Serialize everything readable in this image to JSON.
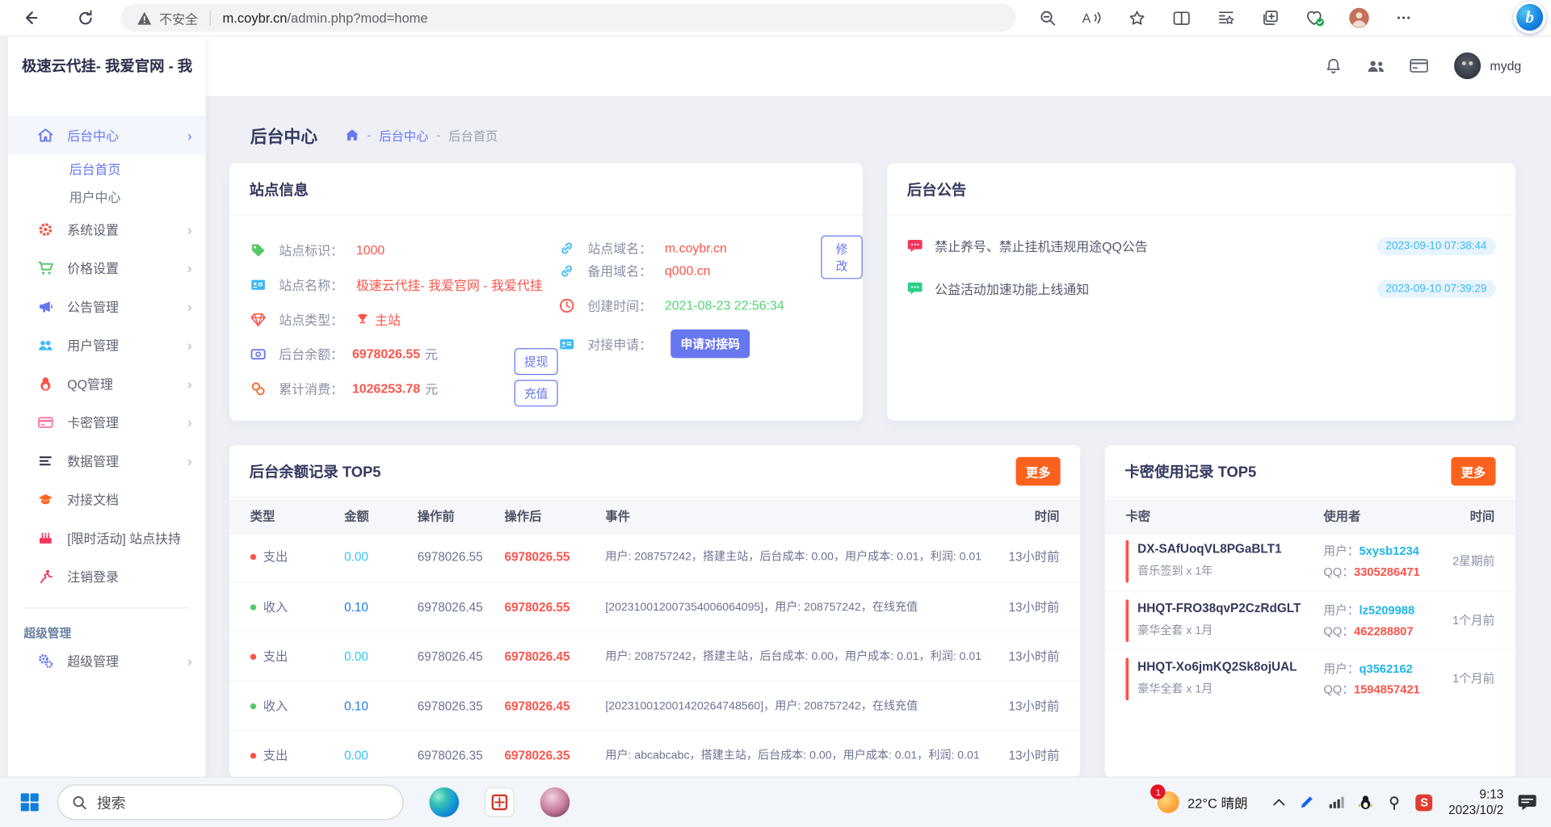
{
  "colors": {
    "accent": "#6777ef",
    "red": "#fc544b",
    "green": "#54ca68",
    "cyan": "#3abaf4",
    "orange_more": "#fb621e",
    "income_blue": "#1d7ce8",
    "time_green": "#4fd473"
  },
  "browser": {
    "security_label": "不安全",
    "url_domain": "m.coybr.cn",
    "url_path": "/admin.php?mod=home"
  },
  "sidebar": {
    "logo": "极速云代挂- 我爱官网 - 我",
    "items": [
      {
        "label": "后台中心"
      },
      {
        "label": "系统设置"
      },
      {
        "label": "价格设置"
      },
      {
        "label": "公告管理"
      },
      {
        "label": "用户管理"
      },
      {
        "label": "QQ管理"
      },
      {
        "label": "卡密管理"
      },
      {
        "label": "数据管理"
      },
      {
        "label": "对接文档"
      },
      {
        "label": "[限时活动] 站点扶持"
      },
      {
        "label": "注销登录"
      }
    ],
    "submenu": [
      {
        "label": "后台首页"
      },
      {
        "label": "用户中心"
      }
    ],
    "section_label": "超级管理",
    "super_item": "超级管理"
  },
  "topbar": {
    "username": "mydg"
  },
  "page": {
    "title": "后台中心",
    "sep": "-",
    "breadcrumb_1": "后台中心",
    "breadcrumb_2": "后台首页"
  },
  "site_info": {
    "title": "站点信息",
    "site_id_label": "站点标识：",
    "site_id": "1000",
    "site_name_label": "站点名称：",
    "site_name": "极速云代挂- 我爱官网 - 我爱代挂",
    "site_type_label": "站点类型：",
    "site_type": "主站",
    "balance_label": "后台余额：",
    "balance": "6978026.55",
    "balance_unit": "元",
    "withdraw_label": "提现",
    "consume_label": "累计消费：",
    "consume": "1026253.78",
    "consume_unit": "元",
    "recharge_label": "充值",
    "domain_label": "站点域名：",
    "domain": "m.coybr.cn",
    "modify_label": "修改",
    "backup_domain_label": "备用域名：",
    "backup_domain": "q000.cn",
    "created_label": "创建时间：",
    "created": "2021-08-23 22:56:34",
    "apply_label": "对接申请：",
    "apply_button": "申请对接码"
  },
  "announcements": {
    "title": "后台公告",
    "items": [
      {
        "text": "禁止养号、禁止挂机违规用途QQ公告",
        "time": "2023-09-10 07:38:44"
      },
      {
        "text": "公益活动加速功能上线通知",
        "time": "2023-09-10 07:39:29"
      }
    ]
  },
  "balance_records": {
    "title": "后台余额记录 TOP5",
    "more_label": "更多",
    "columns": [
      "类型",
      "金额",
      "操作前",
      "操作后",
      "事件",
      "时间"
    ],
    "rows": [
      {
        "type": "支出",
        "amount": "0.00",
        "before": "6978026.55",
        "after": "6978026.55",
        "event": "用户: 208757242，搭建主站，后台成本: 0.00，用户成本: 0.01，利润: 0.01",
        "time": "13小时前"
      },
      {
        "type": "收入",
        "amount": "0.10",
        "before": "6978026.45",
        "after": "6978026.55",
        "event": "[202310012007354006064095]，用户: 208757242，在线充值",
        "time": "13小时前"
      },
      {
        "type": "支出",
        "amount": "0.00",
        "before": "6978026.45",
        "after": "6978026.45",
        "event": "用户: 208757242，搭建主站，后台成本: 0.00，用户成本: 0.01，利润: 0.01",
        "time": "13小时前"
      },
      {
        "type": "收入",
        "amount": "0.10",
        "before": "6978026.35",
        "after": "6978026.45",
        "event": "[202310012001420264748560]，用户: 208757242，在线充值",
        "time": "13小时前"
      },
      {
        "type": "支出",
        "amount": "0.00",
        "before": "6978026.35",
        "after": "6978026.35",
        "event": "用户: abcabcabc，搭建主站，后台成本: 0.00，用户成本: 0.01，利润: 0.01",
        "time": "13小时前"
      }
    ]
  },
  "card_records": {
    "title": "卡密使用记录 TOP5",
    "more_label": "更多",
    "columns": [
      "卡密",
      "使用者",
      "时间"
    ],
    "user_label": "用户：",
    "qq_label": "QQ：",
    "rows": [
      {
        "key": "DX-SAfUoqVL8PGaBLT1",
        "product": "音乐签到 x 1年",
        "user": "5xysb1234",
        "qq": "3305286471",
        "time": "2星期前"
      },
      {
        "key": "HHQT-FRO38qvP2CzRdGLT",
        "product": "豪华全套 x 1月",
        "user": "lz5209988",
        "qq": "462288807",
        "time": "1个月前"
      },
      {
        "key": "HHQT-Xo6jmKQ2Sk8ojUAL",
        "product": "豪华全套 x 1月",
        "user": "q3562162",
        "qq": "1594857421",
        "time": "1个月前"
      }
    ]
  },
  "taskbar": {
    "search_label": "搜索",
    "weather": "22°C 晴朗",
    "notification_count": "1",
    "time": "9:13",
    "date": "2023/10/2"
  }
}
